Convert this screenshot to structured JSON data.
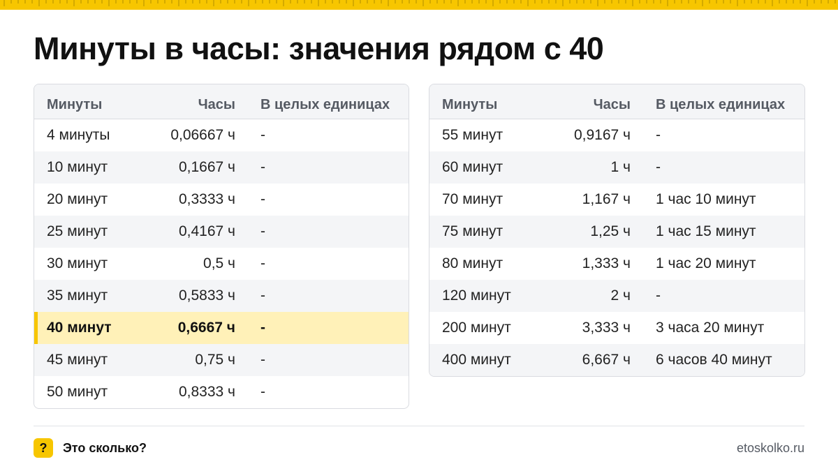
{
  "title": "Минуты в часы: значения рядом с 40",
  "colors": {
    "accent": "#f7c600",
    "highlight_row": "#fff1b8",
    "alt_row": "#f4f5f7",
    "border": "#d9dbe0"
  },
  "columns": [
    "Минуты",
    "Часы",
    "В целых единицах"
  ],
  "left_table": {
    "rows": [
      {
        "minutes": "4 минуты",
        "hours": "0,06667 ч",
        "whole": "-"
      },
      {
        "minutes": "10 минут",
        "hours": "0,1667 ч",
        "whole": "-"
      },
      {
        "minutes": "20 минут",
        "hours": "0,3333 ч",
        "whole": "-"
      },
      {
        "minutes": "25 минут",
        "hours": "0,4167 ч",
        "whole": "-"
      },
      {
        "minutes": "30 минут",
        "hours": "0,5 ч",
        "whole": "-"
      },
      {
        "minutes": "35 минут",
        "hours": "0,5833 ч",
        "whole": "-"
      },
      {
        "minutes": "40 минут",
        "hours": "0,6667 ч",
        "whole": "-",
        "highlighted": true
      },
      {
        "minutes": "45 минут",
        "hours": "0,75 ч",
        "whole": "-"
      },
      {
        "minutes": "50 минут",
        "hours": "0,8333 ч",
        "whole": "-"
      }
    ]
  },
  "right_table": {
    "rows": [
      {
        "minutes": "55 минут",
        "hours": "0,9167 ч",
        "whole": "-"
      },
      {
        "minutes": "60 минут",
        "hours": "1 ч",
        "whole": "-"
      },
      {
        "minutes": "70 минут",
        "hours": "1,167 ч",
        "whole": "1 час 10 минут"
      },
      {
        "minutes": "75 минут",
        "hours": "1,25 ч",
        "whole": "1 час 15 минут"
      },
      {
        "minutes": "80 минут",
        "hours": "1,333 ч",
        "whole": "1 час 20 минут"
      },
      {
        "minutes": "120 минут",
        "hours": "2 ч",
        "whole": "-"
      },
      {
        "minutes": "200 минут",
        "hours": "3,333 ч",
        "whole": "3 часа 20 минут"
      },
      {
        "minutes": "400 минут",
        "hours": "6,667 ч",
        "whole": "6 часов 40 минут"
      }
    ]
  },
  "footer": {
    "badge": "?",
    "brand": "Это сколько?",
    "site": "etoskolko.ru",
    "badge_icon": "question-icon"
  }
}
